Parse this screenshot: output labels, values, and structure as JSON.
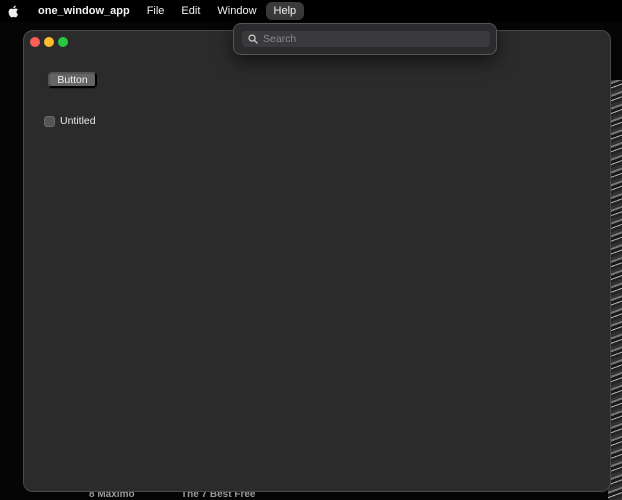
{
  "menubar": {
    "apple_icon": "apple-logo-icon",
    "app_name": "one_window_app",
    "items": [
      {
        "label": "File"
      },
      {
        "label": "Edit"
      },
      {
        "label": "Window"
      },
      {
        "label": "Help"
      }
    ],
    "active_item": "Help"
  },
  "help_menu": {
    "search_icon": "search-icon",
    "search_placeholder": "Search",
    "search_value": ""
  },
  "window": {
    "buttons": {
      "close": "close-icon",
      "minimize": "minimize-icon",
      "zoom": "zoom-icon"
    },
    "button_label": "Button",
    "checkbox": {
      "label": "Untitled",
      "checked": false
    }
  },
  "desktop": {
    "labels": [
      "8 Maximo",
      "The 7 Best Free"
    ]
  },
  "colors": {
    "window_bg": "#2b2b2b",
    "close": "#ff5f57",
    "minimize": "#febc2e",
    "zoom": "#28c840"
  }
}
